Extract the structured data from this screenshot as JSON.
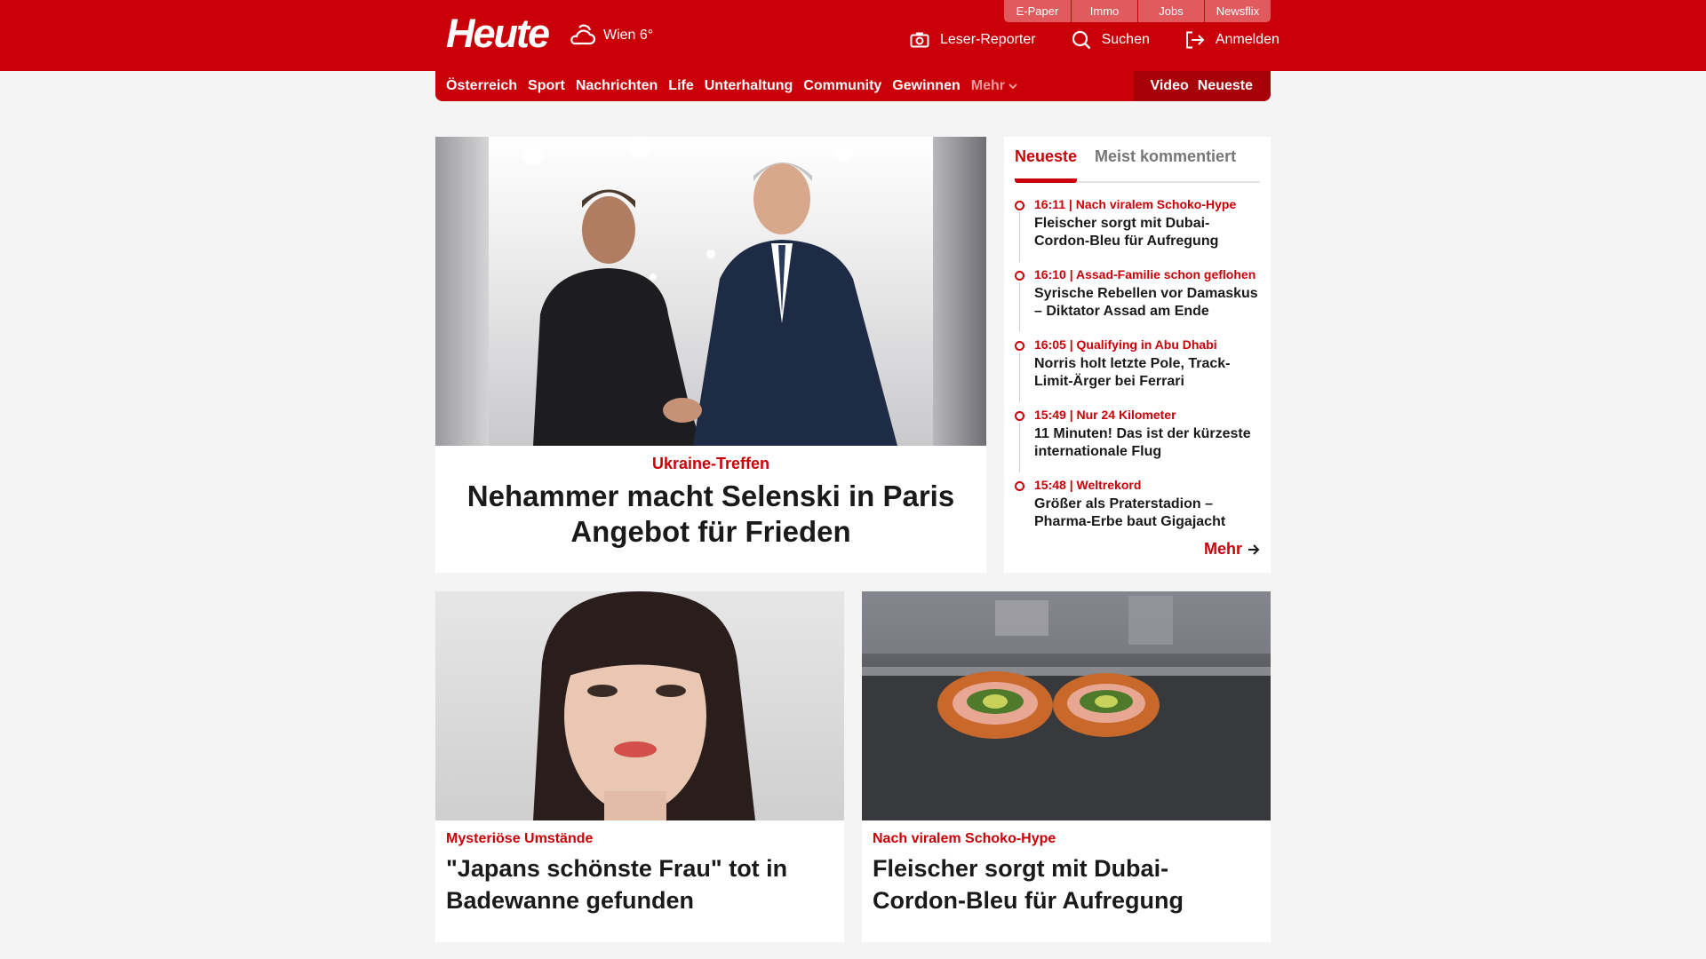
{
  "header": {
    "logo": "Heute",
    "weather_text": "Wien 6°",
    "topbar": [
      "E-Paper",
      "Immo",
      "Jobs",
      "Newsflix"
    ],
    "leser_reporter": "Leser-Reporter",
    "suchen": "Suchen",
    "anmelden": "Anmelden"
  },
  "nav": {
    "items": [
      "Österreich",
      "Sport",
      "Nachrichten",
      "Life",
      "Unterhaltung",
      "Community",
      "Gewinnen"
    ],
    "more": "Mehr",
    "video": "Video",
    "neueste": "Neueste"
  },
  "hero": {
    "kicker": "Ukraine-Treffen",
    "title": "Nehammer macht Selenski in Paris Angebot für Frieden"
  },
  "sidebar": {
    "tabs": [
      "Neueste",
      "Meist kommentiert"
    ],
    "items": [
      {
        "meta": "16:11 | Nach viralem Schoko-Hype",
        "title": "Fleischer sorgt mit Dubai-Cordon-Bleu für Aufregung"
      },
      {
        "meta": "16:10 | Assad-Familie schon geflohen",
        "title": "Syrische Rebellen vor Damaskus – Diktator Assad am Ende"
      },
      {
        "meta": "16:05 | Qualifying in Abu Dhabi",
        "title": "Norris holt letzte Pole, Track-Limit-Ärger bei Ferrari"
      },
      {
        "meta": "15:49 | Nur 24 Kilometer",
        "title": "11 Minuten! Das ist der kürzeste internationale Flug"
      },
      {
        "meta": "15:48 | Weltrekord",
        "title": "Größer als Praterstadion – Pharma-Erbe baut Gigajacht"
      }
    ],
    "more": "Mehr"
  },
  "cards": [
    {
      "kicker": "Mysteriöse Umstände",
      "title": "\"Japans schönste Frau\" tot in Badewanne gefunden"
    },
    {
      "kicker": "Nach viralem Schoko-Hype",
      "title": "Fleischer sorgt mit Dubai-Cordon-Bleu für Aufregung"
    }
  ],
  "colors": {
    "brand_red": "#c90008",
    "background": "#f4f4f4"
  }
}
